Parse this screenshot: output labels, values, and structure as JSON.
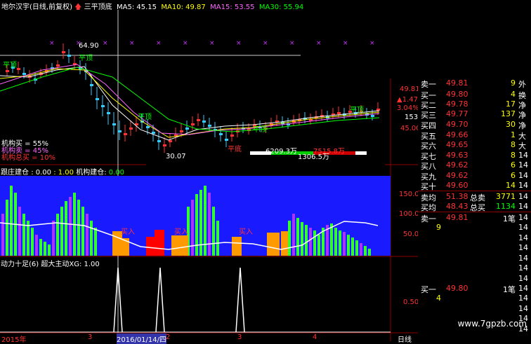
{
  "header": {
    "title": "地尔汉宇(日线,前复权)",
    "indicator": "三平顶底",
    "ma5_label": "MA5:",
    "ma5": "45.15",
    "ma10_label": "MA10:",
    "ma10": "49.87",
    "ma15_label": "MA15:",
    "ma15": "53.55",
    "ma30_label": "MA30:",
    "ma30": "55.94"
  },
  "main_chart": {
    "high_label": "64.90",
    "low_label": "30.07",
    "sanping_top": "平顶",
    "sanping_bottom": "平底",
    "inst_buy": "机构买 = 55%",
    "inst_sell": "机构卖 = 45%",
    "inst_total": "机构总买 = 10%",
    "vol_a": "6209.3万",
    "vol_b": "7515.8万",
    "vol_c": "1306.5万",
    "right_price_top": "49.81",
    "right_change": "1.47",
    "right_pct": "3.04%",
    "right_153": "153",
    "right_45": "45.00"
  },
  "panel2": {
    "title": "跟庄建仓",
    "v1": ": 0.00",
    "v2": ": 1.00",
    "label2": "机构建仓:",
    "v3": "0.00",
    "axis_150": "150.0",
    "axis_100": "100.0",
    "axis_50": "50.0",
    "buy_tag": "买入"
  },
  "panel3": {
    "title": "动力十足(6)",
    "label2": "超大主动XG:",
    "v1": "1.00",
    "axis_050": "0.50"
  },
  "bottom_axis": {
    "year": "2015年",
    "cursor_date": "2016/01/14/四",
    "ticks": [
      "3",
      "2",
      "3",
      "4"
    ],
    "period": "日线"
  },
  "quote": {
    "sell1": {
      "label": "卖一",
      "price": "49.81",
      "vol": "9"
    },
    "buys": [
      {
        "label": "买一",
        "price": "49.80",
        "vol": "4"
      },
      {
        "label": "买二",
        "price": "49.78",
        "vol": "17"
      },
      {
        "label": "买三",
        "price": "49.77",
        "vol": "137"
      },
      {
        "label": "买四",
        "price": "49.70",
        "vol": "30"
      },
      {
        "label": "买五",
        "price": "49.66",
        "vol": "1"
      },
      {
        "label": "买六",
        "price": "49.65",
        "vol": "8"
      },
      {
        "label": "买七",
        "price": "49.63",
        "vol": "8"
      },
      {
        "label": "买八",
        "price": "49.62",
        "vol": "6"
      },
      {
        "label": "买九",
        "price": "49.62",
        "vol": "6"
      },
      {
        "label": "买十",
        "price": "49.60",
        "vol": "14"
      }
    ],
    "side_labels": [
      "外",
      "换",
      "净",
      "净",
      "净",
      "大",
      "大",
      "14",
      "14",
      "14",
      "14",
      "14",
      "14",
      "14",
      "14",
      "14",
      "14",
      "14",
      "14",
      "14",
      "14",
      "14",
      "14",
      "14",
      "14",
      "14",
      "14"
    ],
    "sell_avg_label": "卖均",
    "sell_avg": "51.38",
    "sell_total_label": "总卖",
    "sell_total": "3771",
    "buy_avg_label": "买均",
    "buy_avg": "48.43",
    "buy_total_label": "总买",
    "buy_total": "1134",
    "sell1b_label": "卖一",
    "sell1b_price": "49.81",
    "sell1b_vol": "1笔",
    "sell1b_sub": "9",
    "buy1b_label": "买一",
    "buy1b_price": "49.80",
    "buy1b_vol": "1笔",
    "buy1b_sub": "4",
    "side_14": "14",
    "side_14b": "14"
  },
  "watermark": "www.7gpzb.com",
  "colors": {
    "up": "#ff3333",
    "down": "#33ccff",
    "ma5": "#ffffff",
    "ma10": "#ffff00",
    "ma15": "#ff66ff",
    "ma30": "#00ff00",
    "panel_bg": "#1a1aff"
  }
}
